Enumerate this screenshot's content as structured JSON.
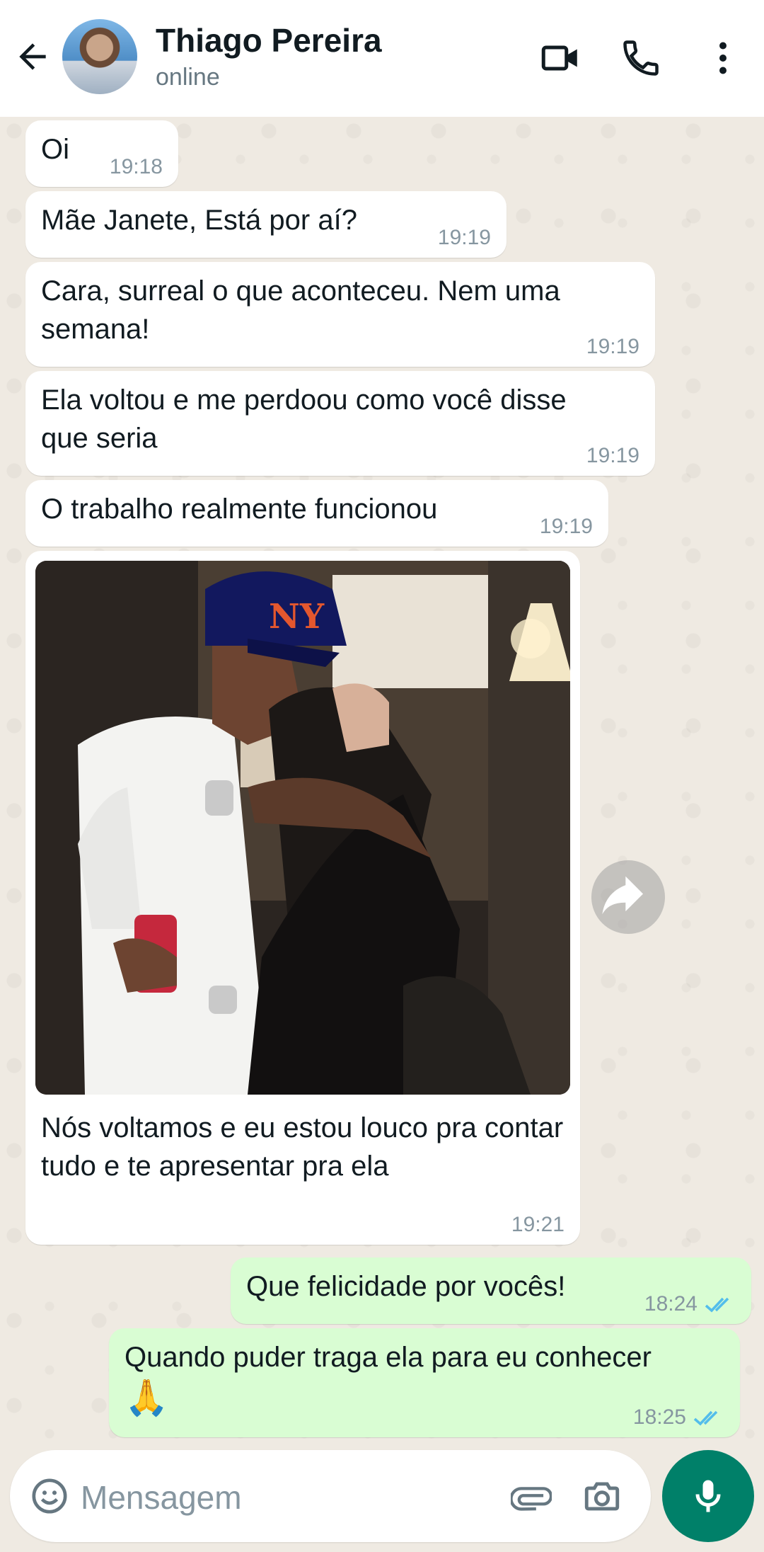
{
  "header": {
    "contact_name": "Thiago Pereira",
    "status": "online"
  },
  "messages": [
    {
      "text": "Oi",
      "time": "19:18"
    },
    {
      "text": "Mãe Janete, Está por aí?",
      "time": "19:19"
    },
    {
      "text": "Cara, surreal o que aconteceu. Nem uma semana!",
      "time": "19:19"
    },
    {
      "text": "Ela voltou e me perdoou como você disse que seria",
      "time": "19:19"
    },
    {
      "text": "O trabalho realmente funcionou",
      "time": "19:19"
    },
    {
      "caption": "Nós voltamos e eu estou louco pra contar tudo e te apresentar pra ela",
      "time": "19:21"
    },
    {
      "text": "Que felicidade por vocês!",
      "time": "18:24"
    },
    {
      "text": "Quando puder traga ela para eu conhecer",
      "emoji": "🙏",
      "time": "18:25"
    }
  ],
  "composer": {
    "placeholder": "Mensagem"
  },
  "colors": {
    "accent": "#008069",
    "outgoing_bubble": "#d9fdd3",
    "read_ticks": "#53bdeb"
  }
}
